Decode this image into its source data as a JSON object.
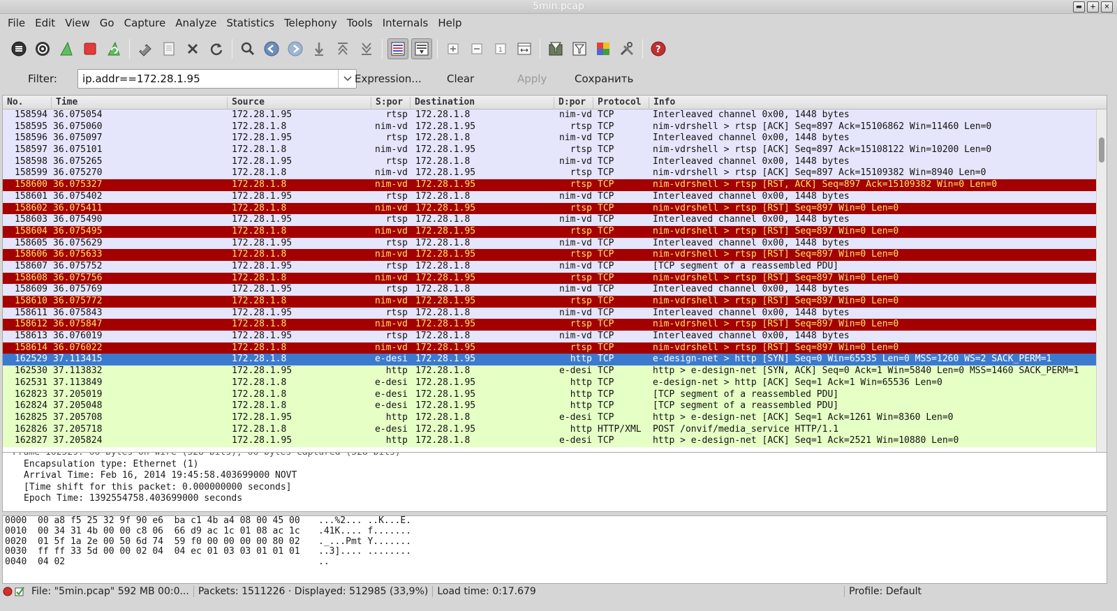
{
  "window": {
    "title": "5min.pcap"
  },
  "menu": [
    "File",
    "Edit",
    "View",
    "Go",
    "Capture",
    "Analyze",
    "Statistics",
    "Telephony",
    "Tools",
    "Internals",
    "Help"
  ],
  "toolbar_icons": [
    "interfaces-icon",
    "options-icon",
    "start-capture-icon",
    "stop-capture-icon",
    "restart-capture-icon",
    "open-icon",
    "save-icon",
    "close-file-icon",
    "reload-icon",
    "find-icon",
    "back-icon",
    "forward-icon",
    "go-to-icon",
    "first-packet-icon",
    "last-packet-icon",
    "colorize-icon",
    "autoscroll-icon",
    "zoom-in-icon",
    "zoom-out-icon",
    "normal-size-icon",
    "resize-columns-icon",
    "capture-filters-icon",
    "display-filters-icon",
    "coloring-rules-icon",
    "preferences-icon",
    "help-icon"
  ],
  "filter": {
    "label": "Filter:",
    "value": "ip.addr==172.28.1.95",
    "expression": "Expression...",
    "clear": "Clear",
    "apply": "Apply",
    "save": "Сохранить"
  },
  "columns": {
    "no": "No.",
    "time": "Time",
    "source": "Source",
    "sport": "S:por",
    "destination": "Destination",
    "dport": "D:por",
    "protocol": "Protocol",
    "info": "Info"
  },
  "packets": [
    {
      "no": "158594",
      "time": "36.075054",
      "src": "172.28.1.95",
      "sport": "rtsp",
      "dst": "172.28.1.8",
      "dport": "nim-vd",
      "proto": "TCP",
      "info": "Interleaved channel 0x00, 1448 bytes",
      "style": "lav"
    },
    {
      "no": "158595",
      "time": "36.075060",
      "src": "172.28.1.8",
      "sport": "nim-vd",
      "dst": "172.28.1.95",
      "dport": "rtsp",
      "proto": "TCP",
      "info": "nim-vdrshell > rtsp [ACK] Seq=897 Ack=15106862 Win=11460 Len=0",
      "style": "lav"
    },
    {
      "no": "158596",
      "time": "36.075097",
      "src": "172.28.1.95",
      "sport": "rtsp",
      "dst": "172.28.1.8",
      "dport": "nim-vd",
      "proto": "TCP",
      "info": "Interleaved channel 0x00, 1448 bytes",
      "style": "lav"
    },
    {
      "no": "158597",
      "time": "36.075101",
      "src": "172.28.1.8",
      "sport": "nim-vd",
      "dst": "172.28.1.95",
      "dport": "rtsp",
      "proto": "TCP",
      "info": "nim-vdrshell > rtsp [ACK] Seq=897 Ack=15108122 Win=10200 Len=0",
      "style": "lav"
    },
    {
      "no": "158598",
      "time": "36.075265",
      "src": "172.28.1.95",
      "sport": "rtsp",
      "dst": "172.28.1.8",
      "dport": "nim-vd",
      "proto": "TCP",
      "info": "Interleaved channel 0x00, 1448 bytes",
      "style": "lav"
    },
    {
      "no": "158599",
      "time": "36.075270",
      "src": "172.28.1.8",
      "sport": "nim-vd",
      "dst": "172.28.1.95",
      "dport": "rtsp",
      "proto": "TCP",
      "info": "nim-vdrshell > rtsp [ACK] Seq=897 Ack=15109382 Win=8940 Len=0",
      "style": "lav"
    },
    {
      "no": "158600",
      "time": "36.075327",
      "src": "172.28.1.8",
      "sport": "nim-vd",
      "dst": "172.28.1.95",
      "dport": "rtsp",
      "proto": "TCP",
      "info": "nim-vdrshell > rtsp [RST, ACK] Seq=897 Ack=15109382 Win=0 Len=0",
      "style": "rst"
    },
    {
      "no": "158601",
      "time": "36.075402",
      "src": "172.28.1.95",
      "sport": "rtsp",
      "dst": "172.28.1.8",
      "dport": "nim-vd",
      "proto": "TCP",
      "info": "Interleaved channel 0x00, 1448 bytes",
      "style": "lav"
    },
    {
      "no": "158602",
      "time": "36.075411",
      "src": "172.28.1.8",
      "sport": "nim-vd",
      "dst": "172.28.1.95",
      "dport": "rtsp",
      "proto": "TCP",
      "info": "nim-vdrshell > rtsp [RST] Seq=897 Win=0 Len=0",
      "style": "rst"
    },
    {
      "no": "158603",
      "time": "36.075490",
      "src": "172.28.1.95",
      "sport": "rtsp",
      "dst": "172.28.1.8",
      "dport": "nim-vd",
      "proto": "TCP",
      "info": "Interleaved channel 0x00, 1448 bytes",
      "style": "lav"
    },
    {
      "no": "158604",
      "time": "36.075495",
      "src": "172.28.1.8",
      "sport": "nim-vd",
      "dst": "172.28.1.95",
      "dport": "rtsp",
      "proto": "TCP",
      "info": "nim-vdrshell > rtsp [RST] Seq=897 Win=0 Len=0",
      "style": "rst"
    },
    {
      "no": "158605",
      "time": "36.075629",
      "src": "172.28.1.95",
      "sport": "rtsp",
      "dst": "172.28.1.8",
      "dport": "nim-vd",
      "proto": "TCP",
      "info": "Interleaved channel 0x00, 1448 bytes",
      "style": "lav"
    },
    {
      "no": "158606",
      "time": "36.075633",
      "src": "172.28.1.8",
      "sport": "nim-vd",
      "dst": "172.28.1.95",
      "dport": "rtsp",
      "proto": "TCP",
      "info": "nim-vdrshell > rtsp [RST] Seq=897 Win=0 Len=0",
      "style": "rst"
    },
    {
      "no": "158607",
      "time": "36.075752",
      "src": "172.28.1.95",
      "sport": "rtsp",
      "dst": "172.28.1.8",
      "dport": "nim-vd",
      "proto": "TCP",
      "info": "[TCP segment of a reassembled PDU]",
      "style": "lav"
    },
    {
      "no": "158608",
      "time": "36.075756",
      "src": "172.28.1.8",
      "sport": "nim-vd",
      "dst": "172.28.1.95",
      "dport": "rtsp",
      "proto": "TCP",
      "info": "nim-vdrshell > rtsp [RST] Seq=897 Win=0 Len=0",
      "style": "rst"
    },
    {
      "no": "158609",
      "time": "36.075769",
      "src": "172.28.1.95",
      "sport": "rtsp",
      "dst": "172.28.1.8",
      "dport": "nim-vd",
      "proto": "TCP",
      "info": "Interleaved channel 0x00, 1448 bytes",
      "style": "lav"
    },
    {
      "no": "158610",
      "time": "36.075772",
      "src": "172.28.1.8",
      "sport": "nim-vd",
      "dst": "172.28.1.95",
      "dport": "rtsp",
      "proto": "TCP",
      "info": "nim-vdrshell > rtsp [RST] Seq=897 Win=0 Len=0",
      "style": "rst"
    },
    {
      "no": "158611",
      "time": "36.075843",
      "src": "172.28.1.95",
      "sport": "rtsp",
      "dst": "172.28.1.8",
      "dport": "nim-vd",
      "proto": "TCP",
      "info": "Interleaved channel 0x00, 1448 bytes",
      "style": "lav"
    },
    {
      "no": "158612",
      "time": "36.075847",
      "src": "172.28.1.8",
      "sport": "nim-vd",
      "dst": "172.28.1.95",
      "dport": "rtsp",
      "proto": "TCP",
      "info": "nim-vdrshell > rtsp [RST] Seq=897 Win=0 Len=0",
      "style": "rst"
    },
    {
      "no": "158613",
      "time": "36.076019",
      "src": "172.28.1.95",
      "sport": "rtsp",
      "dst": "172.28.1.8",
      "dport": "nim-vd",
      "proto": "TCP",
      "info": "Interleaved channel 0x00, 1448 bytes",
      "style": "lav"
    },
    {
      "no": "158614",
      "time": "36.076022",
      "src": "172.28.1.8",
      "sport": "nim-vd",
      "dst": "172.28.1.95",
      "dport": "rtsp",
      "proto": "TCP",
      "info": "nim-vdrshell > rtsp [RST] Seq=897 Win=0 Len=0",
      "style": "rst"
    },
    {
      "no": "162529",
      "time": "37.113415",
      "src": "172.28.1.8",
      "sport": "e-desi",
      "dst": "172.28.1.95",
      "dport": "http",
      "proto": "TCP",
      "info": "e-design-net > http [SYN] Seq=0 Win=65535 Len=0 MSS=1260 WS=2 SACK_PERM=1",
      "style": "sel"
    },
    {
      "no": "162530",
      "time": "37.113832",
      "src": "172.28.1.95",
      "sport": "http",
      "dst": "172.28.1.8",
      "dport": "e-desi",
      "proto": "TCP",
      "info": "http > e-design-net [SYN, ACK] Seq=0 Ack=1 Win=5840 Len=0 MSS=1460 SACK_PERM=1",
      "style": "grn"
    },
    {
      "no": "162531",
      "time": "37.113849",
      "src": "172.28.1.8",
      "sport": "e-desi",
      "dst": "172.28.1.95",
      "dport": "http",
      "proto": "TCP",
      "info": "e-design-net > http [ACK] Seq=1 Ack=1 Win=65536 Len=0",
      "style": "grn"
    },
    {
      "no": "162823",
      "time": "37.205019",
      "src": "172.28.1.8",
      "sport": "e-desi",
      "dst": "172.28.1.95",
      "dport": "http",
      "proto": "TCP",
      "info": "[TCP segment of a reassembled PDU]",
      "style": "grn"
    },
    {
      "no": "162824",
      "time": "37.205048",
      "src": "172.28.1.8",
      "sport": "e-desi",
      "dst": "172.28.1.95",
      "dport": "http",
      "proto": "TCP",
      "info": "[TCP segment of a reassembled PDU]",
      "style": "grn"
    },
    {
      "no": "162825",
      "time": "37.205708",
      "src": "172.28.1.95",
      "sport": "http",
      "dst": "172.28.1.8",
      "dport": "e-desi",
      "proto": "TCP",
      "info": "http > e-design-net [ACK] Seq=1 Ack=1261 Win=8360 Len=0",
      "style": "grn"
    },
    {
      "no": "162826",
      "time": "37.205718",
      "src": "172.28.1.8",
      "sport": "e-desi",
      "dst": "172.28.1.95",
      "dport": "http",
      "proto": "HTTP/XML",
      "info": "POST /onvif/media_service HTTP/1.1",
      "style": "grn"
    },
    {
      "no": "162827",
      "time": "37.205824",
      "src": "172.28.1.95",
      "sport": "http",
      "dst": "172.28.1.8",
      "dport": "e-desi",
      "proto": "TCP",
      "info": "http > e-design-net [ACK] Seq=1 Ack=2521 Win=10880 Len=0",
      "style": "grn"
    }
  ],
  "details": [
    "Encapsulation type: Ethernet (1)",
    "Arrival Time: Feb 16, 2014 19:45:58.403699000 NOVT",
    "[Time shift for this packet: 0.000000000 seconds]",
    "Epoch Time: 1392554758.403699000 seconds"
  ],
  "bytes": [
    {
      "offset": "0000",
      "hex": "00 a8 f5 25 32 9f 90 e6  ba c1 4b a4 08 00 45 00",
      "ascii": "...%2... ..K...E."
    },
    {
      "offset": "0010",
      "hex": "00 34 31 4b 00 00 c8 06  66 d9 ac 1c 01 08 ac 1c",
      "ascii": ".41K.... f......."
    },
    {
      "offset": "0020",
      "hex": "01 5f 1a 2e 00 50 6d 74  59 f0 00 00 00 00 80 02",
      "ascii": "._...Pmt Y......."
    },
    {
      "offset": "0030",
      "hex": "ff ff 33 5d 00 00 02 04  04 ec 01 03 03 01 01 01",
      "ascii": "..3].... ........"
    },
    {
      "offset": "0040",
      "hex": "04 02",
      "ascii": ".."
    }
  ],
  "status": {
    "file": "File: \"5min.pcap\" 592 MB 00:0...",
    "packets": "Packets: 1511226 · Displayed: 512985 (33,9%)",
    "load": "Load time: 0:17.679",
    "profile": "Profile: Default"
  },
  "colors": {
    "rst_bg": "#a40000",
    "rst_fg": "#ffe26a",
    "lavender": "#e5e5fb",
    "green": "#e5ffc5",
    "selected": "#3c7ad0"
  }
}
